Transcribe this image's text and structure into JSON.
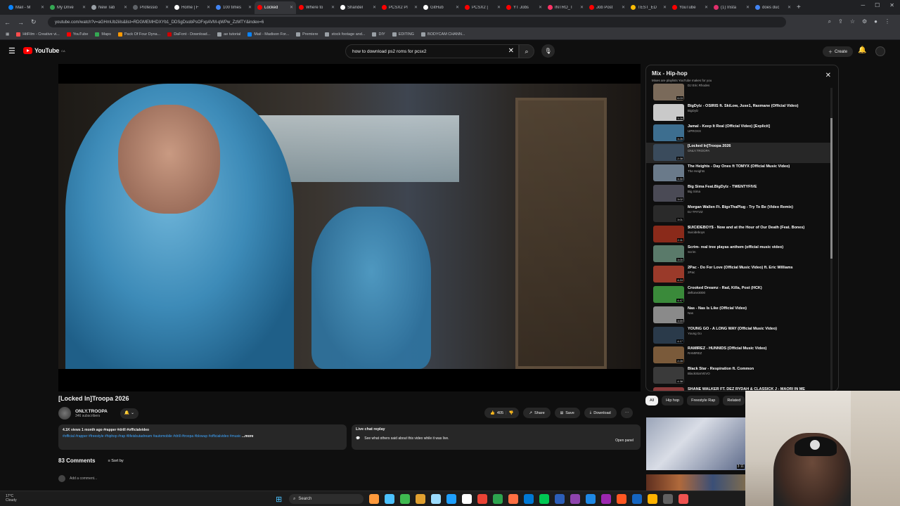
{
  "browser": {
    "tabs": [
      {
        "label": "Mail - M",
        "color": "#0a84ff"
      },
      {
        "label": "My Drive",
        "color": "#34a853"
      },
      {
        "label": "New Tab",
        "color": "#9aa0a6"
      },
      {
        "label": "Professio",
        "color": "#5f6368"
      },
      {
        "label": "Home | F",
        "color": "#ffffff"
      },
      {
        "label": "100 times",
        "color": "#4285f4"
      },
      {
        "label": "Locked",
        "color": "#ff0000"
      },
      {
        "label": "Where to",
        "color": "#ff0000"
      },
      {
        "label": "Shandel",
        "color": "#ffffff"
      },
      {
        "label": "PCSX2 Pl",
        "color": "#ff0000"
      },
      {
        "label": "GitHub",
        "color": "#ffffff"
      },
      {
        "label": "PCSX2 |",
        "color": "#ff0000"
      },
      {
        "label": "YT Jobs",
        "color": "#ff0000"
      },
      {
        "label": "INTRO_T",
        "color": "#ff3366"
      },
      {
        "label": "Job Post",
        "color": "#ff0000"
      },
      {
        "label": "TEST_ED",
        "color": "#fbbc04"
      },
      {
        "label": "YouTube",
        "color": "#ff0000"
      },
      {
        "label": "(1) Insta",
        "color": "#e1306c"
      },
      {
        "label": "does duc",
        "color": "#4285f4"
      }
    ],
    "url": "youtube.com/watch?v=aGHmUb2iils&list=RDGMEMHDXYb1_DDSgDsobPsOFxpAVM-qWPw_ZzMTY&index=6",
    "bookmarks": [
      {
        "label": "HitFilm - Creative vi...",
        "color": "#ff4d4d"
      },
      {
        "label": "YouTube",
        "color": "#ff0000"
      },
      {
        "label": "Maps",
        "color": "#34a853"
      },
      {
        "label": "Pack Of Four Dyna...",
        "color": "#ff9900"
      },
      {
        "label": "DaFont - Download...",
        "color": "#cc0000"
      },
      {
        "label": "ae tutorial",
        "color": "#9aa0a6"
      },
      {
        "label": "Mail - Madison For...",
        "color": "#0a84ff"
      },
      {
        "label": "Premiere",
        "color": "#9aa0a6"
      },
      {
        "label": "stock footage and...",
        "color": "#9aa0a6"
      },
      {
        "label": "DIY",
        "color": "#9aa0a6"
      },
      {
        "label": "EDITING",
        "color": "#9aa0a6"
      },
      {
        "label": "BODYCAM CHANN...",
        "color": "#9aa0a6"
      }
    ]
  },
  "youtube": {
    "logo_text": "YouTube",
    "logo_country": "CA",
    "search_query": "how to download ps2 roms for pcsx2",
    "create_label": "Create"
  },
  "video": {
    "title": "[Locked In]Troopa 2026",
    "channel": "ONLY.TROOPA",
    "subscribers": "346 subscribers",
    "likes": "405",
    "share_label": "Share",
    "save_label": "Save",
    "download_label": "Download",
    "stats": "4.1K views  1 month ago  #rapper #drill #officialvideo",
    "tags": "#official #rapper #freestyle #hiphop #rap #lifeisbutadream #automobile #drill #troopa #blowup #officialvideo #music",
    "more_label": "...more"
  },
  "live_chat": {
    "title": "Live chat replay",
    "body": "See what others said about this video while it was live.",
    "open_label": "Open panel"
  },
  "comments": {
    "count": "83 Comments",
    "sort_label": "Sort by",
    "placeholder": "Add a comment..."
  },
  "playlist": {
    "title": "Mix - Hip-hop",
    "subtitle": "Mixes are playlists YouTube makes for you",
    "items": [
      {
        "title": "",
        "channel": "DJ Eric Rhodes",
        "duration": "6:03",
        "color": "#7a6a5a"
      },
      {
        "title": "BigDylz - OSIRIS ft. SkiLow, Juse1, Raxmane (Official Video)",
        "channel": "BigDylz",
        "duration": "3:28",
        "color": "#c9c9c9"
      },
      {
        "title": "Jamal - Keep It Real (Official Video) [Explicit]",
        "channel": "UPROXX",
        "duration": "3:26",
        "color": "#3d6e8f"
      },
      {
        "title": "[Locked In]Troopa 2026",
        "channel": "ONLY.TROOPA",
        "duration": "2:38",
        "color": "#3a4b5c"
      },
      {
        "title": "The Heights - Day Ones ft TOMYX (Official Music Video)",
        "channel": "The Heights",
        "duration": "3:30",
        "color": "#6a7a8a"
      },
      {
        "title": "Big Sima Feat.BigDylz - TWENTYFIVE",
        "channel": "Big Sima",
        "duration": "3:02",
        "color": "#4a4a55"
      },
      {
        "title": "Morgan Wallen Ft. BigxThaPlug - Try To Be (Video Remix)",
        "channel": "DJ TFITZZ",
        "duration": "3:01",
        "color": "#2a2a2a"
      },
      {
        "title": "$UICIDEBOY$ - Now and at the Hour of Our Death (Feat. Bones)",
        "channel": "Suicideboys",
        "duration": "2:11",
        "color": "#8a2a1a"
      },
      {
        "title": "Scrim- real tree playas anthem (official music video)",
        "channel": "Scrim",
        "duration": "3:00",
        "color": "#5a7a6a"
      },
      {
        "title": "2Pac - Do For Love (Official Music Video) ft. Eric Williams",
        "channel": "2Pac",
        "duration": "4:24",
        "color": "#9a3a2a"
      },
      {
        "title": "Crooked Dreamz - Rad, Killa, Post (HCK)",
        "channel": "deftone3000",
        "duration": "4:47",
        "color": "#3a8a3a"
      },
      {
        "title": "Nas - Nas Is Like (Official Video)",
        "channel": "Nas",
        "duration": "3:59",
        "color": "#8a8a8a"
      },
      {
        "title": "YOUNG GO - A LONG WAY (Official Music Video)",
        "channel": "Young Go",
        "duration": "4:17",
        "color": "#2a3a4a"
      },
      {
        "title": "RAMIREZ - HUNNIDS (Official Music Video)",
        "channel": "RAMIREZ",
        "duration": "2:28",
        "color": "#7a5a3a"
      },
      {
        "title": "Black Star - Respiration ft. Common",
        "channel": "BlackStarVEVO",
        "duration": "4:38",
        "color": "#3a3a3a"
      },
      {
        "title": "SHANE WALKER FT. DEZ RYDAH & CLASSICK J - MAORI IN ME",
        "channel": "",
        "duration": "",
        "color": "#8a3a3a"
      }
    ]
  },
  "chips": [
    "All",
    "Hip hop",
    "Freestyle Rap",
    "Related"
  ],
  "recommended": {
    "duration": "3:11"
  },
  "taskbar": {
    "temperature": "17°C",
    "weather": "Cloudy",
    "search_label": "Search",
    "icons": [
      "#ff9a3c",
      "#4cc2ff",
      "#3fb950",
      "#e0a030",
      "#9cdcfe",
      "#1fa0ff",
      "#ffffff",
      "#ea4335",
      "#2da44e",
      "#ff7043",
      "#0078d4",
      "#00c853",
      "#2c5eb8",
      "#8e44ad",
      "#1e88e5",
      "#9c27b0",
      "#ff5722",
      "#1565c0",
      "#ffb300",
      "#616161",
      "#ef5350"
    ]
  }
}
